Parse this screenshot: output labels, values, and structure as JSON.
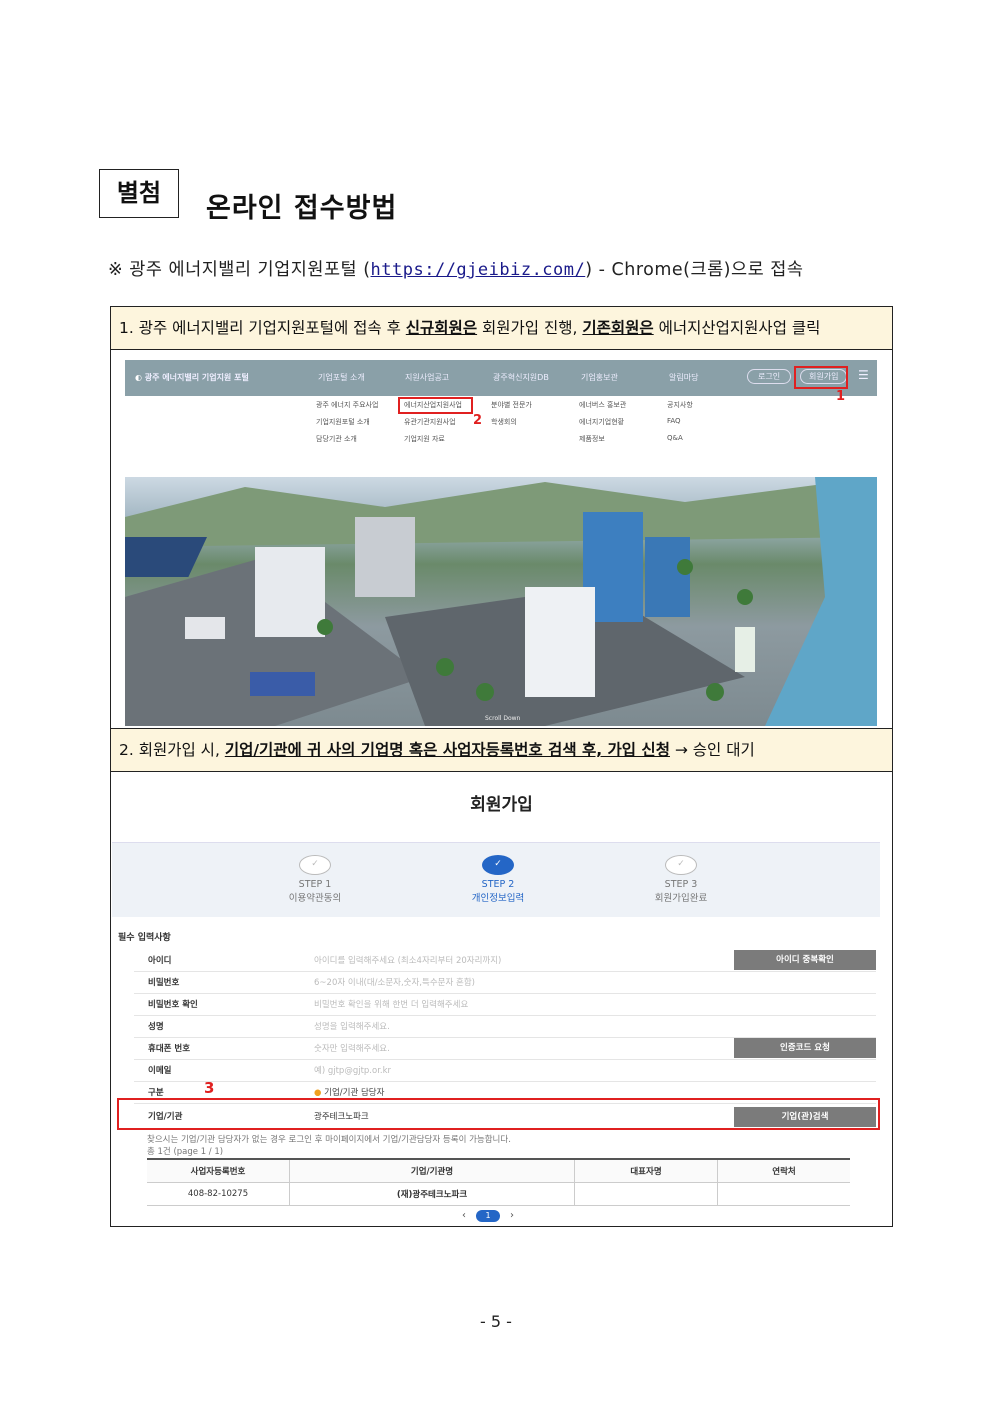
{
  "header": {
    "badge": "별첨",
    "title": "온라인 접수방법"
  },
  "note": {
    "prefix": "※ 광주 에너지밸리 기업지원포털 (",
    "url": "https://gjeibiz.com/",
    "suffix": ") - Chrome(크롬)으로 접속"
  },
  "step1": {
    "num": "1. 광주 에너지밸리 기업지원포털에 접속 후 ",
    "b1": "신규회원은",
    "mid": " 회원가입 진행, ",
    "b2": "기존회원은",
    "end": " 에너지산업지원사업 클릭"
  },
  "portal": {
    "logo": "광주 에너지밸리 기업지원 포털",
    "nav": [
      "기업포털 소개",
      "지원사업공고",
      "광주혁신지원DB",
      "기업홍보관",
      "알림마당"
    ],
    "login": "로그인",
    "signup": "회원가입",
    "menu": [
      [
        "광주 에너지 주요사업",
        "기업지원포털 소개",
        "담당기관 소개"
      ],
      [
        "에너지산업지원사업",
        "유관기관지원사업",
        "기업지원 자료"
      ],
      [
        "분야별 전문가",
        "학생회의"
      ],
      [
        "에너버스 홍보관",
        "에너지기업현황",
        "제품정보"
      ],
      [
        "공지사항",
        "FAQ",
        "Q&A"
      ]
    ],
    "marker1": "1",
    "marker2": "2",
    "scroll": "Scroll Down"
  },
  "step2": {
    "num": "2. 회원가입 시, ",
    "b1": "기업/기관에 귀 사의 기업명 혹은 사업자등록번호 검색 후, 가입 신청",
    "end": " → 승인 대기"
  },
  "signup": {
    "title": "회원가입",
    "steps": [
      {
        "no": "STEP 1",
        "label": "이용약관동의"
      },
      {
        "no": "STEP 2",
        "label": "개인정보입력"
      },
      {
        "no": "STEP 3",
        "label": "회원가입완료"
      }
    ],
    "section": "필수 입력사항",
    "fields": [
      {
        "label": "아이디",
        "placeholder": "아이디를 입력해주세요 (최소4자리부터 20자리까지)",
        "button": "아이디 중복확인"
      },
      {
        "label": "비밀번호",
        "placeholder": "6~20자 이내(대/소문자,숫자,특수문자 혼합)",
        "button": ""
      },
      {
        "label": "비밀번호 확인",
        "placeholder": "비밀번호 확인을 위해 한번 더 입력해주세요",
        "button": ""
      },
      {
        "label": "성명",
        "placeholder": "성명을 입력해주세요.",
        "button": ""
      },
      {
        "label": "휴대폰 번호",
        "placeholder": "숫자만 입력해주세요.",
        "button": "인증코드 요청"
      },
      {
        "label": "이메일",
        "placeholder": "예) gjtp@gjtp.or.kr",
        "button": ""
      },
      {
        "label": "구분",
        "placeholder": "기업/기관 담당자",
        "button": ""
      },
      {
        "label": "기업/기관",
        "placeholder": "광주테크노파크",
        "button": "기업(관)검색"
      }
    ],
    "marker3": "3",
    "hint": "찾으시는 기업/기관 담당자가 없는 경우 로그인 후 마이페이지에서 기업/기관담당자 등록이 가능합니다.",
    "count": "총 1건 (page 1 / 1)",
    "table": {
      "headers": [
        "사업자등록번호",
        "기업/기관명",
        "대표자명",
        "연락처"
      ],
      "rows": [
        [
          "408-82-10275",
          "(재)광주테크노파크",
          "",
          ""
        ]
      ]
    },
    "pager": {
      "prev": "‹",
      "current": "1",
      "next": "›"
    }
  },
  "footer": {
    "page": "- 5 -"
  }
}
